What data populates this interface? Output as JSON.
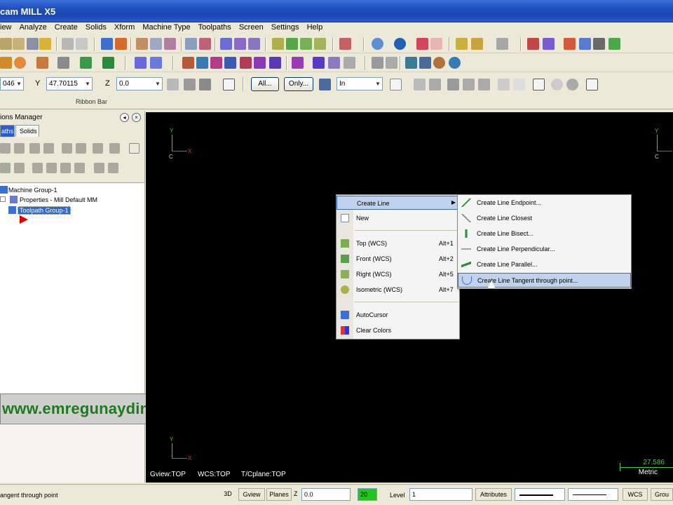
{
  "window": {
    "title": "cam MILL X5"
  },
  "menu": [
    "iew",
    "Analyze",
    "Create",
    "Solids",
    "Xform",
    "Machine Type",
    "Toolpaths",
    "Screen",
    "Settings",
    "Help"
  ],
  "ribbon": {
    "field_x": "046",
    "label_y": "Y",
    "field_y": "47.70115",
    "label_z": "Z",
    "field_z": "0.0",
    "btn_all": "All...",
    "btn_only": "Only...",
    "field_in": "In",
    "label": "Ribbon Bar"
  },
  "manager": {
    "title": "ions Manager",
    "tabs": [
      "aths",
      "Solids"
    ],
    "tree": [
      {
        "label": "Machine Group-1"
      },
      {
        "label": "Properties - Mill Default MM"
      },
      {
        "label": "Toolpath Group-1"
      }
    ]
  },
  "watermark": "www.emregunaydin.com",
  "viewport": {
    "axis_y": "Y",
    "axis_x": "X",
    "axis_c": "C",
    "gview": "Gview:TOP",
    "wcs": "WCS:TOP",
    "tplane": "T/Cplane:TOP",
    "scale_value": "27.586",
    "scale_unit": "Metric"
  },
  "context_menu": {
    "items": [
      {
        "label": "Create Line",
        "shortcut": ""
      },
      {
        "label": "New",
        "shortcut": ""
      },
      {
        "label": "Top (WCS)",
        "shortcut": "Alt+1"
      },
      {
        "label": "Front (WCS)",
        "shortcut": "Alt+2"
      },
      {
        "label": "Right (WCS)",
        "shortcut": "Alt+5"
      },
      {
        "label": "Isometric (WCS)",
        "shortcut": "Alt+7"
      },
      {
        "label": "AutoCursor",
        "shortcut": ""
      },
      {
        "label": "Clear Colors",
        "shortcut": ""
      }
    ],
    "submenu": [
      {
        "label": "Create Line Endpoint..."
      },
      {
        "label": "Create Line Closest"
      },
      {
        "label": "Create Line Bisect..."
      },
      {
        "label": "Create Line Perpendicular..."
      },
      {
        "label": "Create Line Parallel..."
      },
      {
        "label": "Create Line Tangent through point..."
      }
    ]
  },
  "statusbar": {
    "prompt": "angent through point",
    "btn_3d": "3D",
    "btn_gview": "Gview",
    "btn_planes": "Planes",
    "label_z": "Z",
    "field_z": "0.0",
    "field_color": "20",
    "label_level": "Level",
    "field_level": "1",
    "btn_attributes": "Attributes",
    "btn_wcs": "WCS",
    "btn_group": "Grou"
  },
  "colors": {
    "titlebar": "#1f4fbf",
    "viewport_bg": "#000000",
    "selection": "#316ac5",
    "watermark_text": "#1d7a1d",
    "axis_green": "#3cd13c",
    "axis_red": "#ee3333"
  }
}
